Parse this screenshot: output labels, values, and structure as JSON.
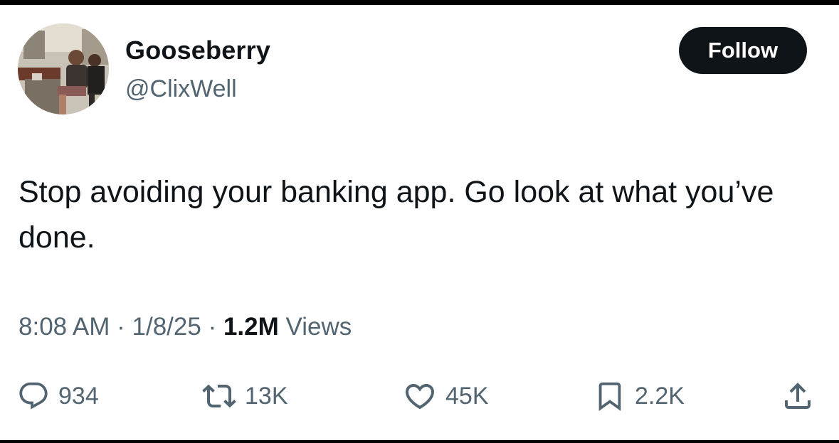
{
  "user": {
    "display_name": "Gooseberry",
    "handle": "@ClixWell"
  },
  "follow_button": {
    "label": "Follow"
  },
  "tweet": {
    "text": "Stop avoiding your banking app. Go look at what you’ve done.",
    "time": "8:08 AM",
    "date": "1/8/25",
    "views_count": "1.2M",
    "views_label": "Views"
  },
  "actions": {
    "reply": {
      "icon": "reply-icon",
      "count": "934"
    },
    "retweet": {
      "icon": "retweet-icon",
      "count": "13K"
    },
    "like": {
      "icon": "heart-icon",
      "count": "45K"
    },
    "bookmark": {
      "icon": "bookmark-icon",
      "count": "2.2K"
    },
    "share": {
      "icon": "share-icon"
    }
  },
  "colors": {
    "text_primary": "#0f1419",
    "text_secondary": "#536471",
    "button_bg": "#0f1419",
    "button_text": "#ffffff"
  }
}
